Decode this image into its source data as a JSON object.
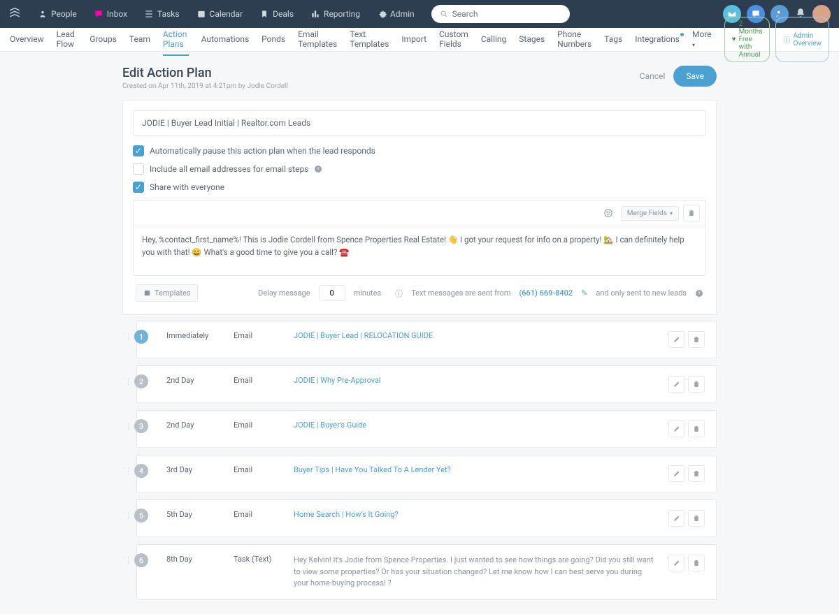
{
  "topbar": {
    "items": [
      {
        "icon": "people",
        "label": "People"
      },
      {
        "icon": "inbox",
        "label": "Inbox"
      },
      {
        "icon": "tasks",
        "label": "Tasks"
      },
      {
        "icon": "calendar",
        "label": "Calendar"
      },
      {
        "icon": "deals",
        "label": "Deals"
      },
      {
        "icon": "reporting",
        "label": "Reporting"
      },
      {
        "icon": "admin",
        "label": "Admin"
      }
    ],
    "search_placeholder": "Search"
  },
  "subnav": {
    "items": [
      "Overview",
      "Lead Flow",
      "Groups",
      "Team",
      "Action Plans",
      "Automations",
      "Ponds",
      "Email Templates",
      "Text Templates",
      "Import",
      "Custom Fields",
      "Calling",
      "Stages",
      "Phone Numbers",
      "Tags",
      "Integrations",
      "More"
    ],
    "active_index": 4,
    "dot_index": 15,
    "pill_promo": "2 Months Free with Annual",
    "pill_admin": "Admin Overview"
  },
  "header": {
    "title": "Edit Action Plan",
    "meta": "Created on Apr 11th, 2019 at 4:21pm by Jodie Cordell",
    "cancel": "Cancel",
    "save": "Save"
  },
  "form": {
    "name_value": "JODIE | Buyer Lead Initial | Realtor.com Leads",
    "chk_pause": "Automatically pause this action plan when the lead responds",
    "chk_emails": "Include all email addresses for email steps",
    "chk_share": "Share with everyone",
    "merge_fields": "Merge Fields",
    "message": "Hey, %contact_first_name%! This is Jodie Cordell from Spence Properties Real Estate! 👋 I got your request for info on a property! 🏡 I can definitely help you with that! 😀 What's a good time to give you a call? ☎️",
    "templates_btn": "Templates",
    "delay_label": "Delay message",
    "delay_value": "0",
    "delay_unit": "minutes",
    "sent_from_prefix": "Text messages are sent from",
    "phone": "(661) 669-8402",
    "sent_from_suffix": "and only sent to new leads"
  },
  "steps": [
    {
      "n": "1",
      "timing": "Immediately",
      "type": "Email",
      "title": "JODIE | Buyer Lead | RELOCATION GUIDE",
      "link": true
    },
    {
      "n": "2",
      "timing": "2nd Day",
      "type": "Email",
      "title": "JODIE | Why Pre-Approval",
      "link": true
    },
    {
      "n": "3",
      "timing": "2nd Day",
      "type": "Email",
      "title": "JODIE | Buyer's Guide",
      "link": true
    },
    {
      "n": "4",
      "timing": "3rd Day",
      "type": "Email",
      "title": "Buyer Tips | Have You Talked To A Lender Yet?",
      "link": true
    },
    {
      "n": "5",
      "timing": "5th Day",
      "type": "Email",
      "title": "Home Search | How's It Going?",
      "link": true
    },
    {
      "n": "6",
      "timing": "8th Day",
      "type": "Task (Text)",
      "title": "Hey Kelvin! It's Jodie from Spence Properties. I just wanted to see how things are going? Did you still want to view some properties? Or has your situation changed? Let me know how I can best serve you during your home-buying process! ?",
      "link": false
    }
  ]
}
